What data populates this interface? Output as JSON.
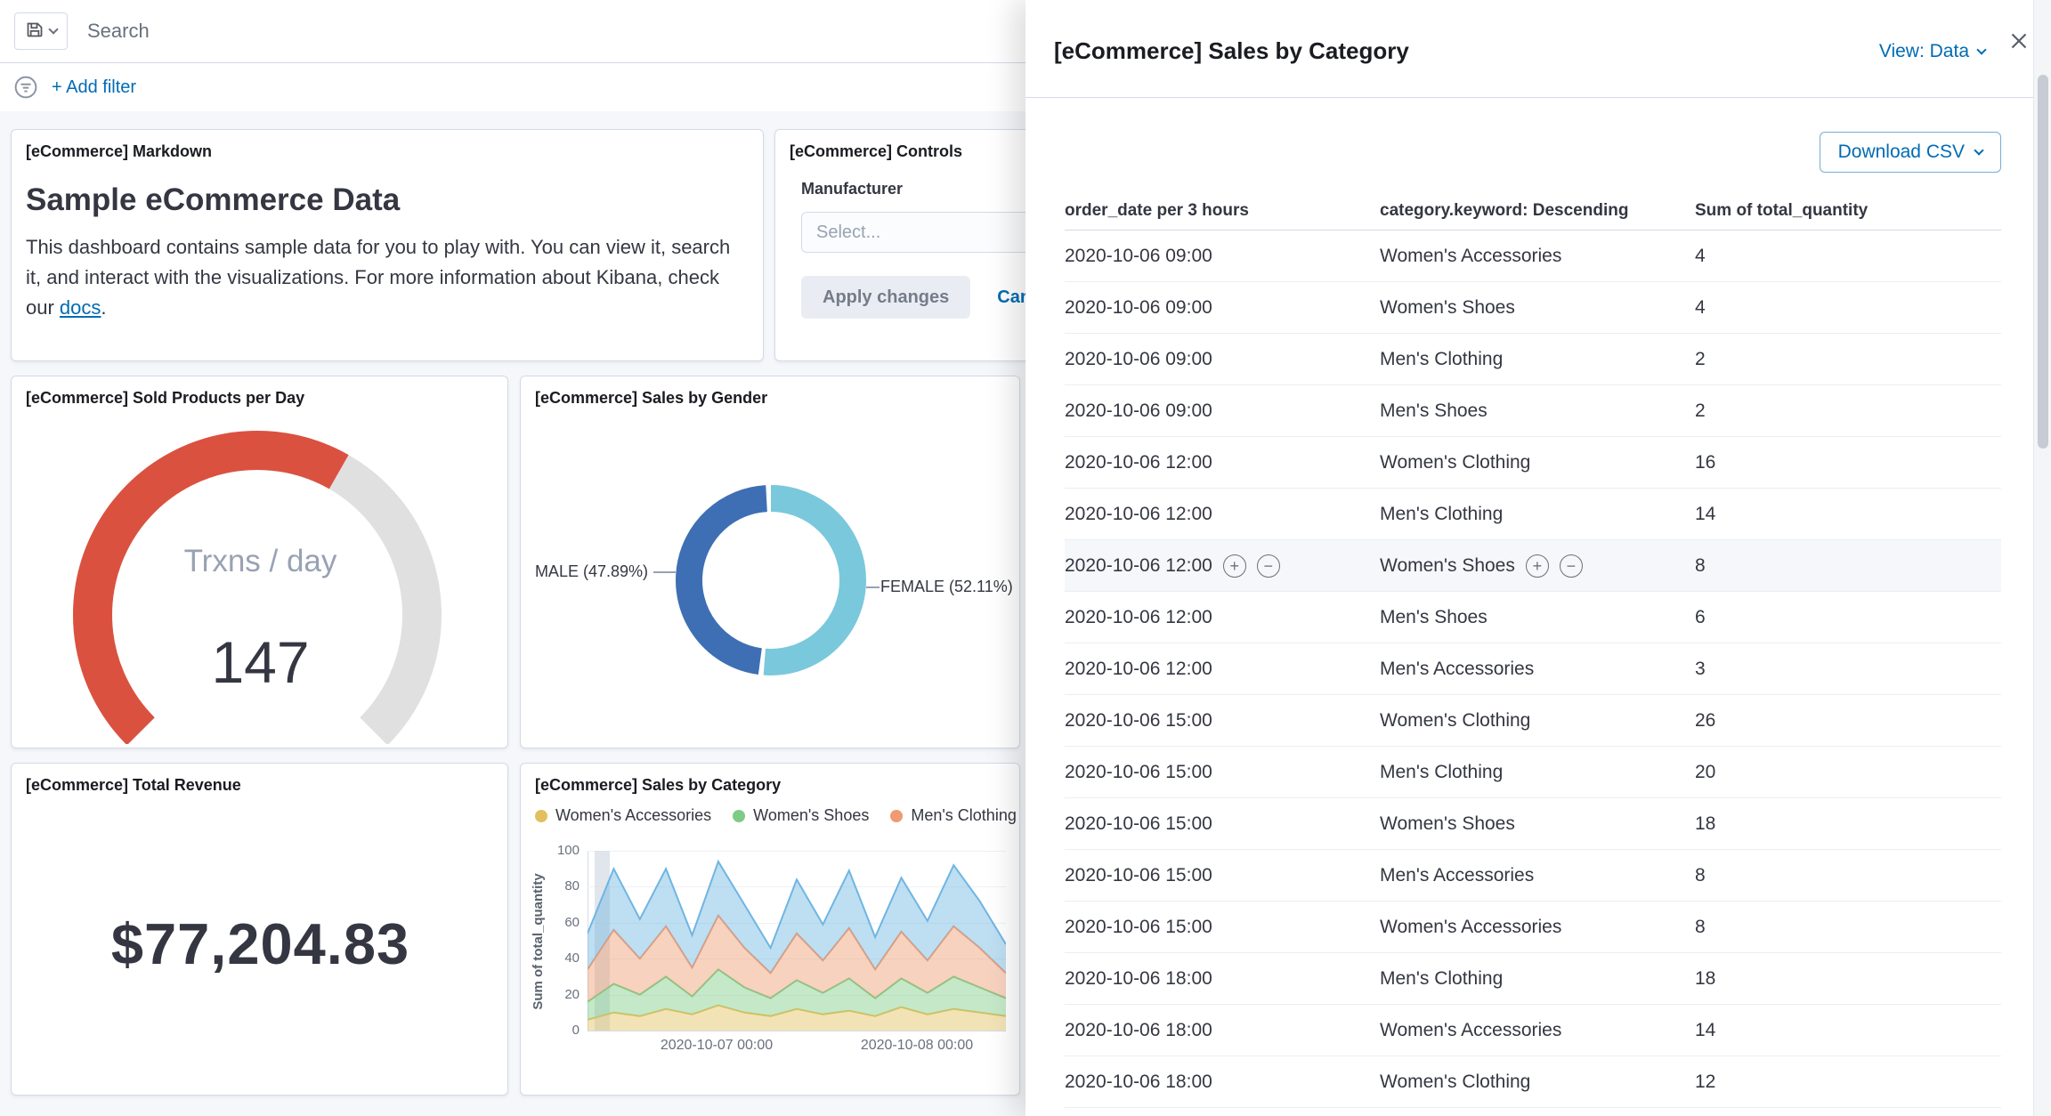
{
  "topbar": {
    "search_placeholder": "Search",
    "add_filter_label": "+ Add filter"
  },
  "panels": {
    "markdown": {
      "title": "[eCommerce] Markdown",
      "heading": "Sample eCommerce Data",
      "body_before": "This dashboard contains sample data for you to play with. You can view it, search it, and interact with the visualizations. For more information about Kibana, check our ",
      "link_text": "docs",
      "body_after": "."
    },
    "controls": {
      "title": "[eCommerce] Controls",
      "field_label": "Manufacturer",
      "select_placeholder": "Select...",
      "apply_label": "Apply changes",
      "cancel_label": "Cancel changes"
    },
    "gauge": {
      "title": "[eCommerce] Sold Products per Day",
      "label": "Trxns / day",
      "value": "147",
      "fraction": 0.61,
      "color": "#DB5140",
      "track_color": "#E0E0E0"
    },
    "gender": {
      "title": "[eCommerce] Sales by Gender",
      "slices": [
        {
          "label": "FEMALE (52.11%)",
          "pct": 52.11,
          "color": "#7AC8DB"
        },
        {
          "label": "MALE (47.89%)",
          "pct": 47.89,
          "color": "#3E6FB4"
        }
      ]
    },
    "revenue": {
      "title": "[eCommerce] Total Revenue",
      "value": "$77,204.83"
    },
    "category": {
      "title": "[eCommerce] Sales by Category",
      "ylabel": "Sum of total_quantity",
      "ymax": 100,
      "yticks": [
        100,
        80,
        60,
        40,
        20,
        0
      ],
      "xticks": [
        "2020-10-07 00:00",
        "2020-10-08 00:00"
      ],
      "legend": [
        {
          "label": "Women's Accessories",
          "color": "#E2C05F"
        },
        {
          "label": "Women's Shoes",
          "color": "#7FCB85"
        },
        {
          "label": "Men's Clothing",
          "color": "#EE9B72"
        }
      ],
      "series": [
        {
          "name": "Women's Accessories",
          "color": "#E2C05F",
          "values": [
            6,
            10,
            8,
            12,
            9,
            14,
            10,
            8,
            12,
            9,
            11,
            8,
            13,
            9,
            12,
            10,
            8
          ]
        },
        {
          "name": "Women's Shoes",
          "color": "#7FCB85",
          "values": [
            10,
            16,
            12,
            18,
            10,
            20,
            14,
            10,
            16,
            12,
            18,
            10,
            16,
            12,
            18,
            14,
            10
          ]
        },
        {
          "name": "Men's Clothing",
          "color": "#EE9B72",
          "values": [
            18,
            30,
            20,
            28,
            16,
            30,
            22,
            14,
            26,
            18,
            28,
            16,
            26,
            18,
            28,
            22,
            14
          ]
        },
        {
          "name": "Women's Clothing",
          "color": "#6FB5E2",
          "values": [
            20,
            34,
            22,
            32,
            18,
            30,
            24,
            14,
            30,
            20,
            32,
            18,
            30,
            22,
            34,
            26,
            16
          ]
        }
      ]
    }
  },
  "flyout": {
    "title": "[eCommerce] Sales by Category",
    "view_label": "View: Data",
    "download_label": "Download CSV",
    "columns": [
      "order_date per 3 hours",
      "category.keyword: Descending",
      "Sum of total_quantity"
    ],
    "hover_row_index": 6,
    "rows": [
      [
        "2020-10-06 09:00",
        "Women's Accessories",
        "4"
      ],
      [
        "2020-10-06 09:00",
        "Women's Shoes",
        "4"
      ],
      [
        "2020-10-06 09:00",
        "Men's Clothing",
        "2"
      ],
      [
        "2020-10-06 09:00",
        "Men's Shoes",
        "2"
      ],
      [
        "2020-10-06 12:00",
        "Women's Clothing",
        "16"
      ],
      [
        "2020-10-06 12:00",
        "Men's Clothing",
        "14"
      ],
      [
        "2020-10-06 12:00",
        "Women's Shoes",
        "8"
      ],
      [
        "2020-10-06 12:00",
        "Men's Shoes",
        "6"
      ],
      [
        "2020-10-06 12:00",
        "Men's Accessories",
        "3"
      ],
      [
        "2020-10-06 15:00",
        "Women's Clothing",
        "26"
      ],
      [
        "2020-10-06 15:00",
        "Men's Clothing",
        "20"
      ],
      [
        "2020-10-06 15:00",
        "Women's Shoes",
        "18"
      ],
      [
        "2020-10-06 15:00",
        "Men's Accessories",
        "8"
      ],
      [
        "2020-10-06 15:00",
        "Women's Accessories",
        "8"
      ],
      [
        "2020-10-06 18:00",
        "Men's Clothing",
        "18"
      ],
      [
        "2020-10-06 18:00",
        "Women's Accessories",
        "14"
      ],
      [
        "2020-10-06 18:00",
        "Women's Clothing",
        "12"
      ]
    ]
  }
}
